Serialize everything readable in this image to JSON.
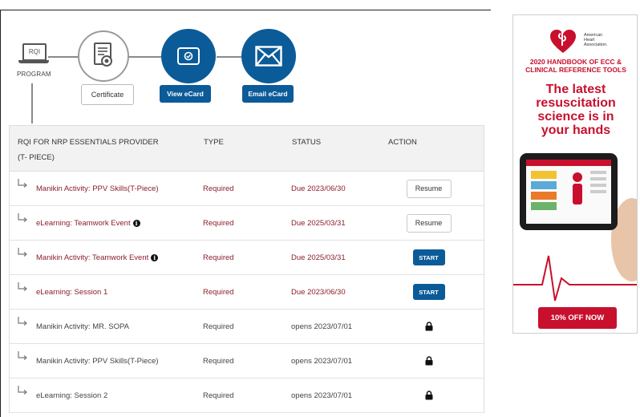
{
  "progress": {
    "program_screen_label": "RQI",
    "program_label": "PROGRAM",
    "certificate_button": "Certificate",
    "view_ecard_button": "View eCard",
    "email_ecard_button": "Email eCard"
  },
  "table": {
    "headers": {
      "course_line1": "RQI FOR NRP ESSENTIALS PROVIDER",
      "course_line2": "(T- PIECE)",
      "type": "TYPE",
      "status": "STATUS",
      "action": "ACTION"
    },
    "rows": [
      {
        "name": "Manikin Activity: PPV Skills(T-Piece)",
        "info": false,
        "type": "Required",
        "status": "Due 2023/06/30",
        "action": "Resume"
      },
      {
        "name": "eLearning: Teamwork Event",
        "info": true,
        "type": "Required",
        "status": "Due 2025/03/31",
        "action": "Resume"
      },
      {
        "name": "Manikin Activity: Teamwork Event",
        "info": true,
        "type": "Required",
        "status": "Due 2025/03/31",
        "action": "START"
      },
      {
        "name": "eLearning: Session 1",
        "info": false,
        "type": "Required",
        "status": "Due 2023/06/30",
        "action": "START"
      },
      {
        "name": "Manikin Activity: MR. SOPA",
        "info": false,
        "type": "Required",
        "status": "opens 2023/07/01",
        "action": "lock"
      },
      {
        "name": "Manikin Activity: PPV Skills(T-Piece)",
        "info": false,
        "type": "Required",
        "status": "opens 2023/07/01",
        "action": "lock"
      },
      {
        "name": "eLearning: Session 2",
        "info": false,
        "type": "Required",
        "status": "opens 2023/07/01",
        "action": "lock"
      }
    ]
  },
  "ad": {
    "logo_text_1": "American",
    "logo_text_2": "Heart",
    "logo_text_3": "Association.",
    "subtitle_line1": "2020 HANDBOOK OF ECC &",
    "subtitle_line2": "CLINICAL REFERENCE TOOLS",
    "headline_line1": "The latest",
    "headline_line2": "resuscitation",
    "headline_line3": "science is in",
    "headline_line4": "your hands",
    "cta": "10% OFF NOW"
  },
  "colors": {
    "primary_blue": "#0b5b99",
    "required_red": "#8b1f2b",
    "aha_red": "#c8102e"
  }
}
